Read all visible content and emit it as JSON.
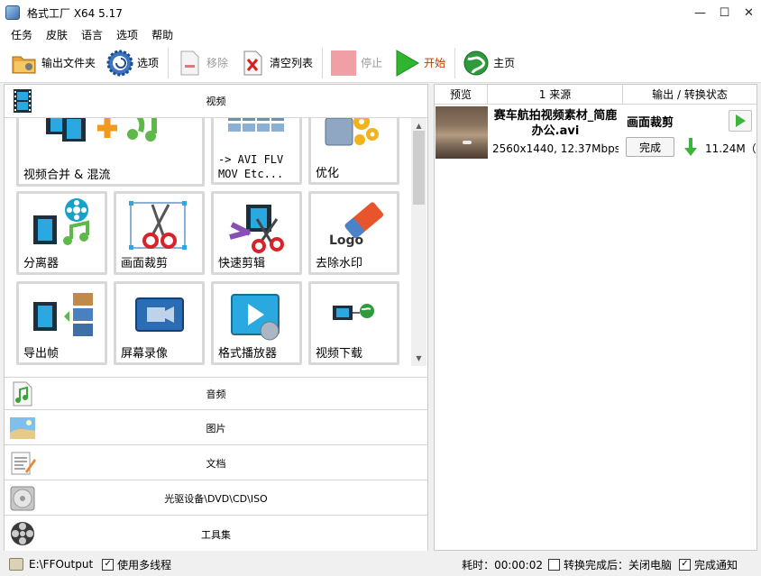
{
  "window": {
    "title": "格式工厂 X64 5.17",
    "minimize": "—",
    "maximize": "☐",
    "close": "✕"
  },
  "menu": [
    "任务",
    "皮肤",
    "语言",
    "选项",
    "帮助"
  ],
  "toolbar": {
    "output_folder": "输出文件夹",
    "options": "选项",
    "remove": "移除",
    "clear_list": "清空列表",
    "stop": "停止",
    "start": "开始",
    "home": "主页"
  },
  "categories": {
    "video": "视频",
    "audio": "音频",
    "picture": "图片",
    "document": "文档",
    "rom": "光驱设备\\DVD\\CD\\ISO",
    "tools": "工具集"
  },
  "tiles": [
    {
      "label": "视频合并 & 混流",
      "icon": "video-merge-icon"
    },
    {
      "label": "-> AVI FLV MOV Etc...",
      "line1": "-> AVI FLV",
      "line2": "MOV Etc...",
      "icon": "format-convert-icon"
    },
    {
      "label": "优化",
      "icon": "optimize-icon"
    },
    {
      "label": "分离器",
      "icon": "demuxer-icon"
    },
    {
      "label": "画面裁剪",
      "icon": "crop-icon"
    },
    {
      "label": "快速剪辑",
      "icon": "quick-clip-icon"
    },
    {
      "label": "去除水印",
      "icon": "remove-watermark-icon",
      "logo_text": "Logo"
    },
    {
      "label": "导出帧",
      "icon": "export-frames-icon"
    },
    {
      "label": "屏幕录像",
      "icon": "screen-record-icon"
    },
    {
      "label": "格式播放器",
      "icon": "player-icon"
    },
    {
      "label": "视频下载",
      "icon": "video-download-icon"
    }
  ],
  "task_table": {
    "headers": [
      "预览",
      "1 来源",
      "输出 / 转换状态"
    ],
    "rows": [
      {
        "filename": "赛车航拍视频素材_简鹿办公.avi",
        "info": "2560x1440, 12.37Mbps,",
        "operation": "画面裁剪",
        "status": "完成",
        "output_size": "11.24M（"
      }
    ]
  },
  "status": {
    "output_path": "E:\\FFOutput",
    "multithread": "使用多线程",
    "elapsed": "耗时：00:00:02",
    "after_convert": "转换完成后：关闭电脑",
    "notify": "完成通知"
  },
  "colors": {
    "accent_green": "#3cb43c",
    "border": "#c9c9c9"
  }
}
